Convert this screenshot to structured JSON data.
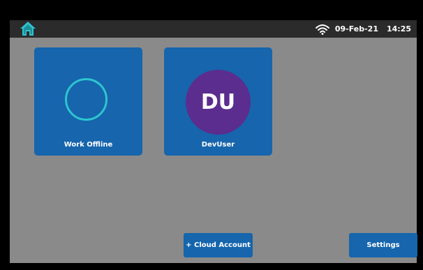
{
  "status": {
    "date": "09-Feb-21",
    "time": "14:25",
    "wifi_icon": "wifi-icon",
    "home_icon": "home-icon"
  },
  "tiles": [
    {
      "label": "Work Offline",
      "icon": "offline-ring-icon"
    },
    {
      "label": "DevUser",
      "initials": "DU"
    }
  ],
  "buttons": {
    "cloud_account": "+ Cloud Account",
    "settings": "Settings"
  },
  "colors": {
    "background": "#8a8a8a",
    "topbar": "#2b2b2b",
    "tile": "#1665ad",
    "ring": "#2ec4d0",
    "avatar": "#5b2d8e",
    "home_icon": "#2ec4d0"
  }
}
